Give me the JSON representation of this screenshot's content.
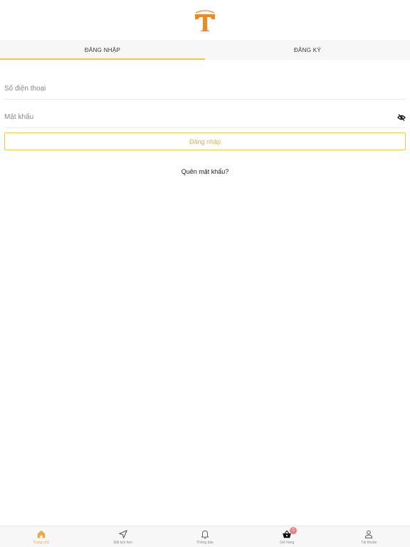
{
  "header": {
    "logo_icon": "brand-t-logo",
    "brand_color": "#F08A1A"
  },
  "tabs": [
    {
      "label": "ĐĂNG NHẬP",
      "active": true
    },
    {
      "label": "ĐĂNG KÝ",
      "active": false
    }
  ],
  "form": {
    "phone_placeholder": "Số điện thoại",
    "phone_value": "",
    "password_placeholder": "Mật khẩu",
    "password_value": "",
    "password_toggle_icon": "eye-slash-icon",
    "login_label": "Đăng nhập",
    "forgot_label": "Quên mật khẩu?"
  },
  "bottom_nav": [
    {
      "label": "Trang chủ",
      "icon": "home-icon",
      "active": true
    },
    {
      "label": "Đặt lịch hẹn",
      "icon": "send-icon",
      "active": false
    },
    {
      "label": "Thông báo",
      "icon": "bell-icon",
      "active": false
    },
    {
      "label": "Giỏ hàng",
      "icon": "basket-icon",
      "active": false,
      "badge": "0"
    },
    {
      "label": "Tài khoản",
      "icon": "user-icon",
      "active": false
    }
  ],
  "colors": {
    "accent": "#F0C84A",
    "accent_text": "#E8B637",
    "active_nav": "#F3A640",
    "badge": "#EF7D7D"
  }
}
